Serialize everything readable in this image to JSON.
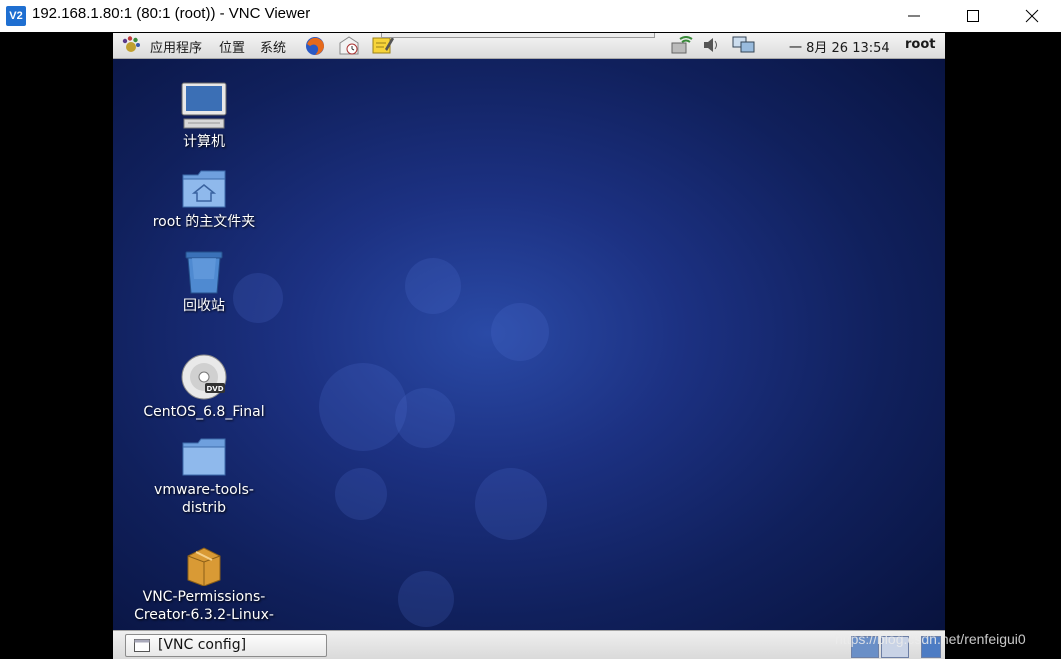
{
  "window": {
    "app_icon_text": "V2",
    "title": "192.168.1.80:1 (80:1 (root)) - VNC Viewer"
  },
  "gnome_panel": {
    "menus": [
      "应用程序",
      "位置",
      "系统"
    ],
    "clock": "一 8月 26 13:54",
    "user": "root"
  },
  "desktop_icons": [
    {
      "label": "计算机"
    },
    {
      "label": "root 的主文件夹"
    },
    {
      "label": "回收站"
    },
    {
      "label": "CentOS_6.8_Final"
    },
    {
      "label": "vmware-tools-distrib"
    },
    {
      "label": "VNC-Permissions-Creator-6.3.2-Linux-"
    }
  ],
  "dvd_badge": "DVD",
  "taskbar": {
    "window_button": "[VNC config]"
  },
  "watermark": "https://blog.csdn.net/renfeigui0",
  "colors": {
    "desktop_center": "#2a4aa6",
    "desktop_edge": "#07113a",
    "panel": "#e6e6e6"
  }
}
